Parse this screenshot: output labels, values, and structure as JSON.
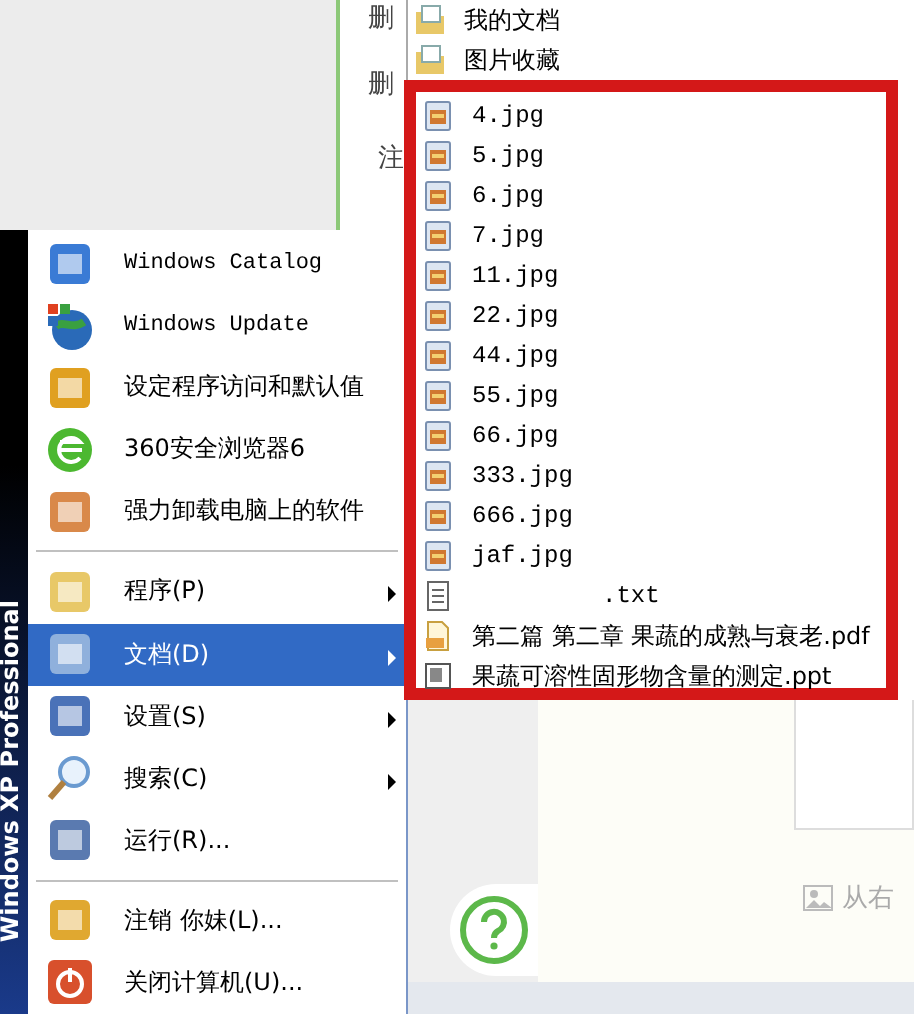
{
  "background_page": {
    "labels": [
      "删",
      "删",
      "注"
    ],
    "image_hint": "从右"
  },
  "start_menu": {
    "side_banner": "Windows XP Professional",
    "items": [
      {
        "label": "Windows Catalog",
        "kind": "catalog",
        "submenu": false,
        "selected": false
      },
      {
        "label": "Windows Update",
        "kind": "update",
        "submenu": false,
        "selected": false
      },
      {
        "label": "设定程序访问和默认值",
        "kind": "defaults",
        "submenu": false,
        "selected": false
      },
      {
        "label": "360安全浏览器6",
        "kind": "browser",
        "submenu": false,
        "selected": false
      },
      {
        "label": "强力卸载电脑上的软件",
        "kind": "uninstall",
        "submenu": false,
        "selected": false
      },
      {
        "kind": "separator"
      },
      {
        "label": "程序(P)",
        "kind": "programs",
        "submenu": true,
        "selected": false
      },
      {
        "label": "文档(D)",
        "kind": "documents",
        "submenu": true,
        "selected": true
      },
      {
        "label": "设置(S)",
        "kind": "settings",
        "submenu": true,
        "selected": false
      },
      {
        "label": "搜索(C)",
        "kind": "search",
        "submenu": true,
        "selected": false
      },
      {
        "label": "运行(R)...",
        "kind": "run",
        "submenu": false,
        "selected": false
      },
      {
        "kind": "separator"
      },
      {
        "label": "注销 你妹(L)...",
        "kind": "logoff",
        "submenu": false,
        "selected": false
      },
      {
        "label": "关闭计算机(U)...",
        "kind": "shutdown",
        "submenu": false,
        "selected": false
      }
    ]
  },
  "documents_menu": {
    "folders": [
      {
        "label": "我的文档",
        "kind": "folder"
      },
      {
        "label": "图片收藏",
        "kind": "folder"
      }
    ],
    "recent": [
      {
        "label": "4.jpg",
        "kind": "jpg"
      },
      {
        "label": "5.jpg",
        "kind": "jpg"
      },
      {
        "label": "6.jpg",
        "kind": "jpg"
      },
      {
        "label": "7.jpg",
        "kind": "jpg"
      },
      {
        "label": "11.jpg",
        "kind": "jpg"
      },
      {
        "label": "22.jpg",
        "kind": "jpg"
      },
      {
        "label": "44.jpg",
        "kind": "jpg"
      },
      {
        "label": "55.jpg",
        "kind": "jpg"
      },
      {
        "label": "66.jpg",
        "kind": "jpg"
      },
      {
        "label": "333.jpg",
        "kind": "jpg"
      },
      {
        "label": "666.jpg",
        "kind": "jpg"
      },
      {
        "label": "jaf.jpg",
        "kind": "jpg"
      },
      {
        "label": ".txt",
        "kind": "txt",
        "name_hidden": true
      },
      {
        "label": "第二篇 第二章 果蔬的成熟与衰老.pdf",
        "kind": "pdf"
      },
      {
        "label": "果蔬可溶性固形物含量的测定.ppt",
        "kind": "ppt"
      }
    ]
  }
}
